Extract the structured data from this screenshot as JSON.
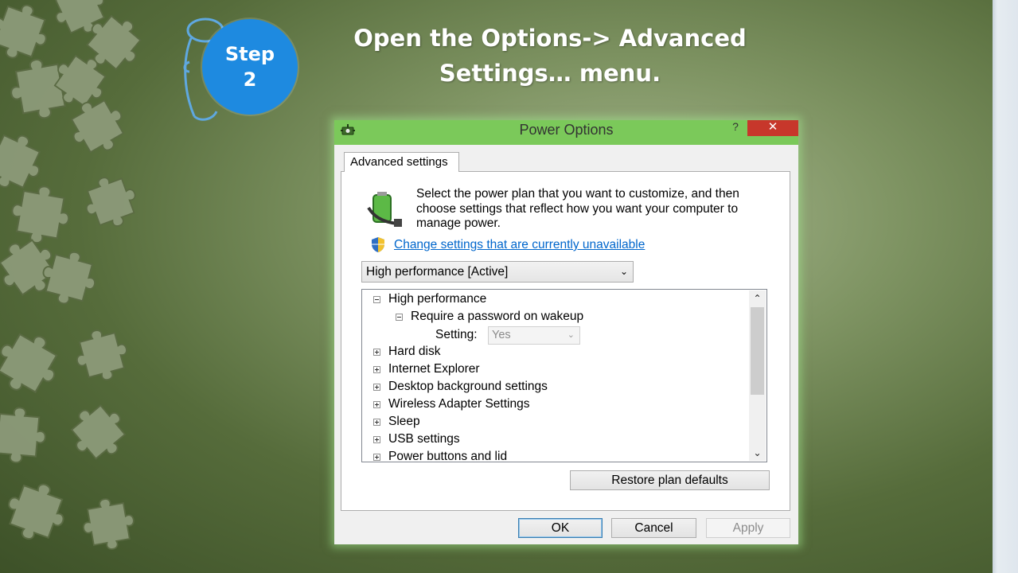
{
  "slide": {
    "step": {
      "line1": "Step",
      "line2": "2"
    },
    "headline": {
      "line1": "Open the Options-> Advanced",
      "line2": "Settings… menu."
    }
  },
  "dialog": {
    "title": "Power Options",
    "help": "?",
    "close": "✕",
    "tab": "Advanced settings",
    "intro": "Select the power plan that you want to customize, and then choose settings that reflect how you want your computer to manage power.",
    "link": "Change settings that are currently unavailable",
    "plan_select": {
      "value": "High performance [Active]",
      "arrow": "⌄"
    },
    "tree": {
      "items": [
        {
          "label": "High performance",
          "expanded": true
        },
        {
          "label": "Require a password on wakeup",
          "expanded": true
        },
        {
          "label": "Hard disk",
          "expanded": false
        },
        {
          "label": "Internet Explorer",
          "expanded": false
        },
        {
          "label": "Desktop background settings",
          "expanded": false
        },
        {
          "label": "Wireless Adapter Settings",
          "expanded": false
        },
        {
          "label": "Sleep",
          "expanded": false
        },
        {
          "label": "USB settings",
          "expanded": false
        },
        {
          "label": "Power buttons and lid",
          "expanded": false
        }
      ],
      "setting_label": "Setting:",
      "setting_value": "Yes",
      "scroll_up": "⌃",
      "scroll_down": "⌄"
    },
    "buttons": {
      "restore": "Restore plan defaults",
      "ok": "OK",
      "cancel": "Cancel",
      "apply": "Apply"
    }
  },
  "colors": {
    "dialog_frame": "#7bc95a",
    "step_circle": "#1e8ae0",
    "link": "#0066cc",
    "close": "#c7372b"
  }
}
